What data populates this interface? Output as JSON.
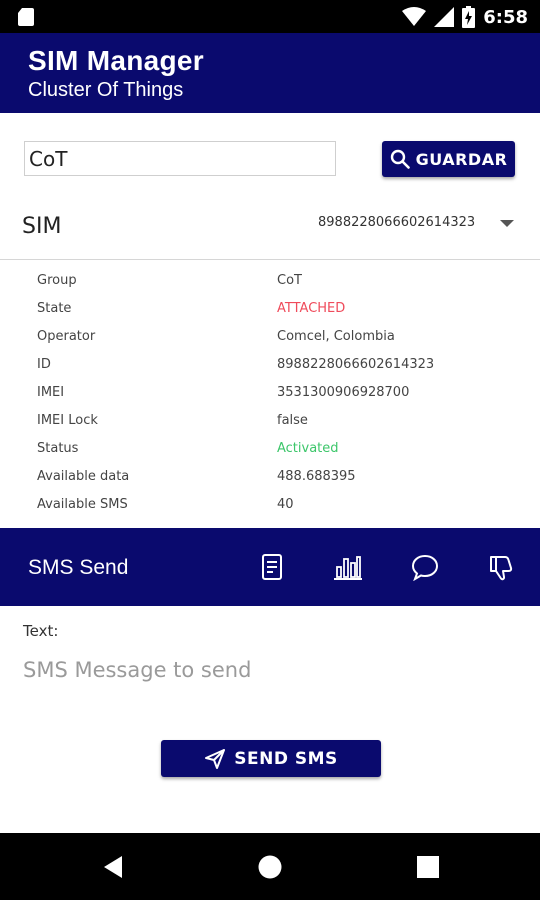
{
  "status_bar": {
    "time": "6:58",
    "icons": [
      "sd-card-icon",
      "wifi-icon",
      "signal-icon",
      "battery-charging-icon"
    ]
  },
  "app_bar": {
    "title": "SIM Manager",
    "subtitle": "Cluster Of Things"
  },
  "form": {
    "name_value": "CoT",
    "save_label": "GUARDAR"
  },
  "sim_selector": {
    "label": "SIM",
    "selected": "8988228066602614323"
  },
  "details": [
    {
      "key": "Group",
      "value": "CoT",
      "color": "#444444"
    },
    {
      "key": "State",
      "value": "ATTACHED",
      "color": "#ef4b5b"
    },
    {
      "key": "Operator",
      "value": "Comcel, Colombia",
      "color": "#444444"
    },
    {
      "key": "ID",
      "value": "8988228066602614323",
      "color": "#444444"
    },
    {
      "key": "IMEI",
      "value": "3531300906928700",
      "color": "#444444"
    },
    {
      "key": "IMEI Lock",
      "value": "false",
      "color": "#444444"
    },
    {
      "key": "Status",
      "value": "Activated",
      "color": "#3cc66a"
    },
    {
      "key": "Available data",
      "value": "488.688395",
      "color": "#444444"
    },
    {
      "key": "Available SMS",
      "value": "40",
      "color": "#444444"
    }
  ],
  "sms_bar": {
    "title": "SMS Send",
    "icons": [
      "document-icon",
      "bar-chart-icon",
      "chat-bubble-icon",
      "thumbs-down-icon"
    ]
  },
  "sms_form": {
    "text_label": "Text:",
    "placeholder": "SMS Message to send",
    "send_label": "SEND SMS"
  },
  "colors": {
    "primary": "#0a0a6e",
    "attached": "#ef4b5b",
    "activated": "#3cc66a"
  }
}
